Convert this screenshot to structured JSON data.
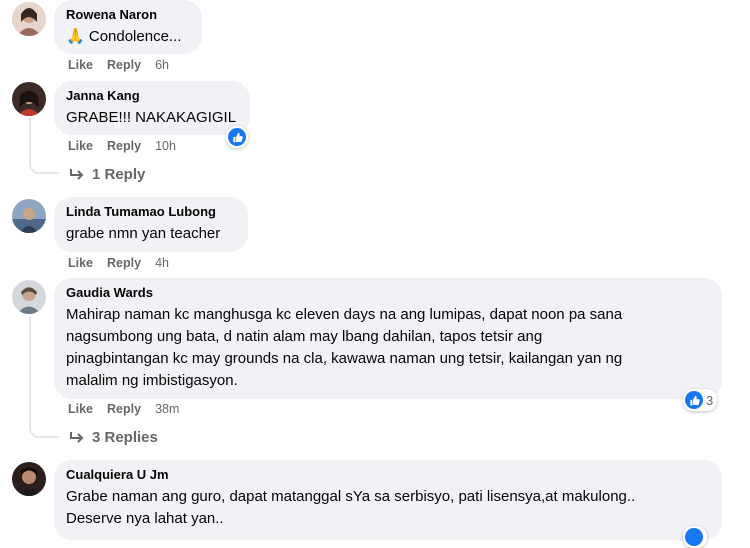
{
  "colors": {
    "bubble": "#f0f2f5",
    "meta": "#65676b",
    "like": "#1877f2"
  },
  "labels": {
    "like": "Like",
    "reply": "Reply"
  },
  "comments": [
    {
      "name": "Rowena Naron",
      "emoji": "🙏",
      "lines": [
        "Condolence..."
      ],
      "time": "6h"
    },
    {
      "name": "Janna Kang",
      "lines": [
        "GRABE!!! NAKAKAGIGIL"
      ],
      "time": "10h",
      "reaction_icon": "like-icon",
      "replies_label": "1 Reply"
    },
    {
      "name": "Linda Tumamao Lubong",
      "lines": [
        "grabe nmn yan teacher"
      ],
      "time": "4h"
    },
    {
      "name": "Gaudia Wards",
      "lines": [
        "Mahirap naman kc manghusga kc eleven days na ang lumipas, dapat noon pa sana",
        "nagsumbong ung bata, d natin alam may lbang dahilan, tapos tetsir ang",
        "pinagbintangan kc may grounds na cla, kawawa naman ung tetsir, kailangan yan ng",
        "malalim ng imbistigasyon."
      ],
      "time": "38m",
      "reaction_icon": "like-icon",
      "reaction_count": "3",
      "replies_label": "3 Replies"
    },
    {
      "name": "Cualquiera U Jm",
      "lines": [
        "Grabe naman ang guro, dapat matanggal sYa sa serbisyo, pati lisensya,at makulong..",
        "Deserve nya lahat yan.."
      ]
    }
  ]
}
